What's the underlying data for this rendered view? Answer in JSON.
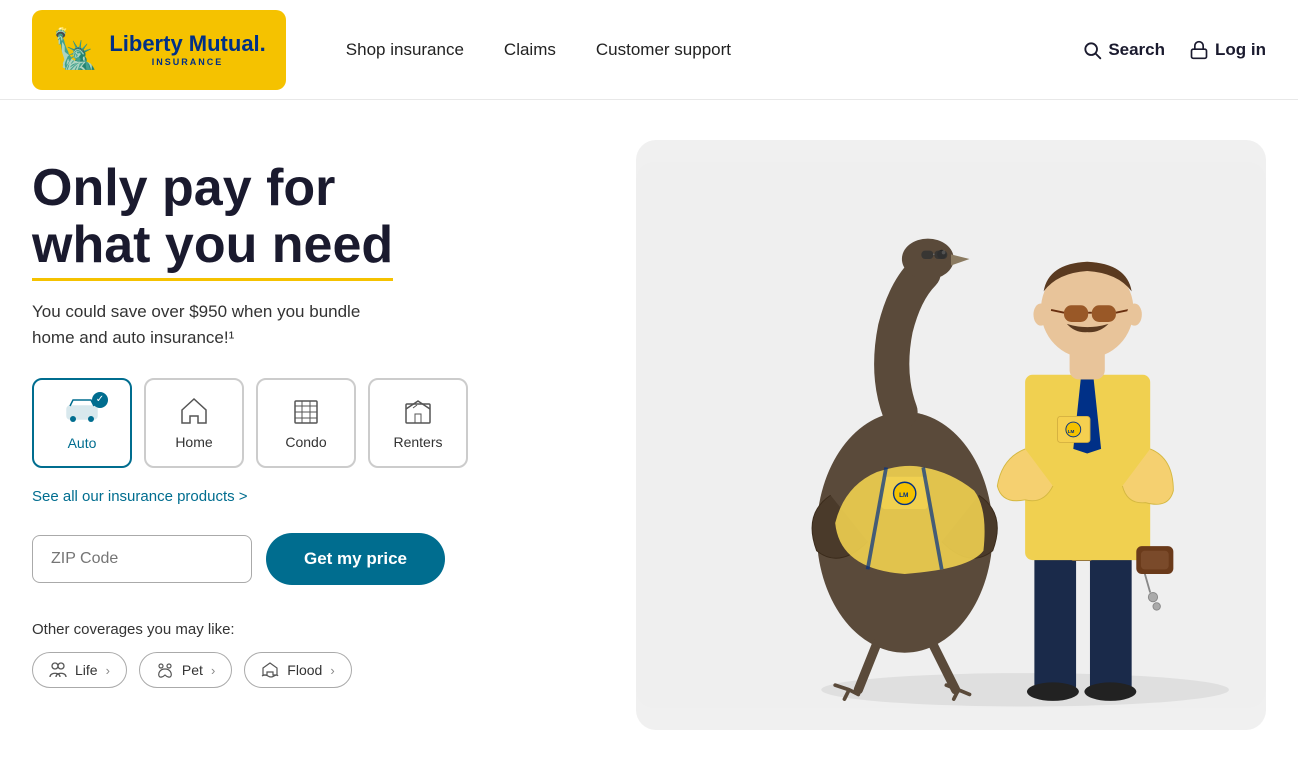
{
  "logo": {
    "icon": "🗽",
    "main": "Liberty Mutual.",
    "sub": "INSURANCE"
  },
  "nav": {
    "links": [
      {
        "id": "shop-insurance",
        "label": "Shop insurance"
      },
      {
        "id": "claims",
        "label": "Claims"
      },
      {
        "id": "customer-support",
        "label": "Customer support"
      }
    ],
    "search_label": "Search",
    "login_label": "Log in"
  },
  "hero": {
    "title_line1": "Only pay for",
    "title_line2": "what you need",
    "subtitle": "You could save over $950 when you bundle\nhome and auto insurance!¹",
    "see_all_label": "See all our insurance products >",
    "zip_placeholder": "ZIP Code",
    "cta_label": "Get my price",
    "other_coverages_label": "Other coverages you may like:",
    "tabs": [
      {
        "id": "auto",
        "label": "Auto",
        "icon": "🚗",
        "active": true
      },
      {
        "id": "home",
        "label": "Home",
        "icon": "🏠",
        "active": false
      },
      {
        "id": "condo",
        "label": "Condo",
        "icon": "🏢",
        "active": false
      },
      {
        "id": "renters",
        "label": "Renters",
        "icon": "🏠",
        "active": false
      }
    ],
    "pills": [
      {
        "id": "life",
        "label": "Life",
        "icon": "👥"
      },
      {
        "id": "pet",
        "label": "Pet",
        "icon": "🐾"
      },
      {
        "id": "flood",
        "label": "Flood",
        "icon": "🏠"
      }
    ]
  },
  "colors": {
    "brand_yellow": "#f5c200",
    "brand_blue": "#003087",
    "teal": "#006d8f",
    "bg_gray": "#f0f0f0"
  }
}
